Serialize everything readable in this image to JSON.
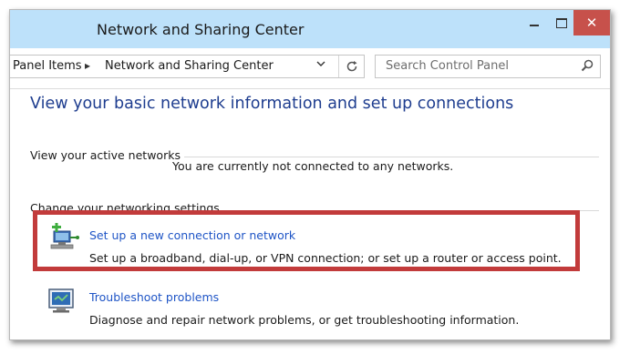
{
  "window": {
    "title": "Network and Sharing Center",
    "controls": {
      "minimize": "minimize",
      "maximize": "maximize",
      "close": "close"
    }
  },
  "address_bar": {
    "breadcrumbs": [
      "Panel Items",
      "Network and Sharing Center"
    ],
    "separator": "▸"
  },
  "search": {
    "placeholder": "Search Control Panel"
  },
  "main": {
    "heading": "View your basic network information and set up connections",
    "active_networks": {
      "label": "View your active networks",
      "status": "You are currently not connected to any networks."
    },
    "settings": {
      "label": "Change your networking settings",
      "tasks": [
        {
          "link": "Set up a new connection or network",
          "description": "Set up a broadband, dial-up, or VPN connection; or set up a router or access point.",
          "icon": "new-connection-icon"
        },
        {
          "link": "Troubleshoot problems",
          "description": "Diagnose and repair network problems, or get troubleshooting information.",
          "icon": "troubleshoot-icon"
        }
      ]
    }
  },
  "colors": {
    "titlebar": "#bde1fa",
    "close_button": "#c7514b",
    "heading": "#1e3d8f",
    "link": "#1f55c6",
    "highlight_box": "#c23b3b"
  }
}
